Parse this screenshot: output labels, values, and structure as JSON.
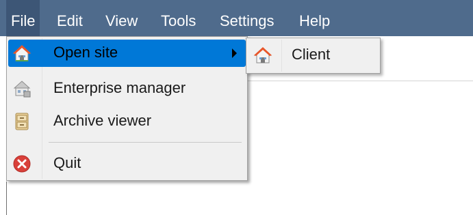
{
  "menubar": {
    "items": [
      {
        "label": "File"
      },
      {
        "label": "Edit"
      },
      {
        "label": "View"
      },
      {
        "label": "Tools"
      },
      {
        "label": "Settings"
      },
      {
        "label": "Help"
      }
    ]
  },
  "file_menu": {
    "items": [
      {
        "label": "Open site",
        "icon": "home-icon",
        "selected": true,
        "has_submenu": true
      },
      {
        "label": "Enterprise manager",
        "icon": "enterprise-icon"
      },
      {
        "label": "Archive viewer",
        "icon": "archive-cabinet-icon"
      },
      {
        "label": "Quit",
        "icon": "quit-icon"
      }
    ]
  },
  "open_site_submenu": {
    "items": [
      {
        "label": "Client",
        "icon": "home-icon"
      }
    ]
  },
  "colors": {
    "menubar_bg": "#4f6b8c",
    "selection": "#0078d7",
    "menu_bg": "#f0f0f0",
    "quit_icon": "#d9403a"
  }
}
